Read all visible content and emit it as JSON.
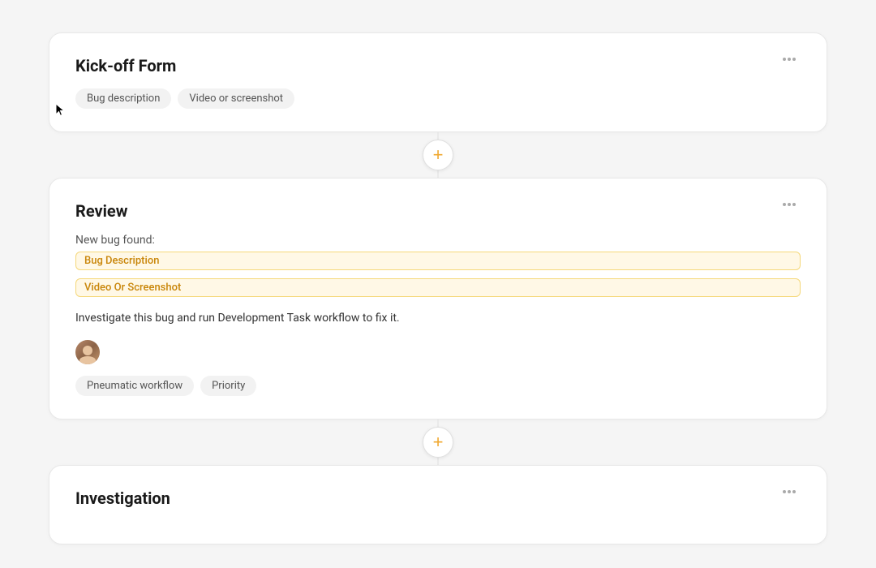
{
  "cards": {
    "kickoff": {
      "title": "Kick-off Form",
      "tags": [
        "Bug description",
        "Video or screenshot"
      ],
      "more_label": "···"
    },
    "review": {
      "title": "Review",
      "new_bug_label": "New bug found:",
      "bug_description_tag": "Bug Description",
      "video_screenshot_tag": "Video Or Screenshot",
      "investigate_text": "Investigate this bug and run Development Task workflow to fix it.",
      "workflow_tag": "Pneumatic workflow",
      "priority_tag": "Priority",
      "more_label": "···"
    },
    "investigation": {
      "title": "Investigation",
      "more_label": "···"
    }
  },
  "add_button_label": "+",
  "icons": {
    "more": "···"
  }
}
